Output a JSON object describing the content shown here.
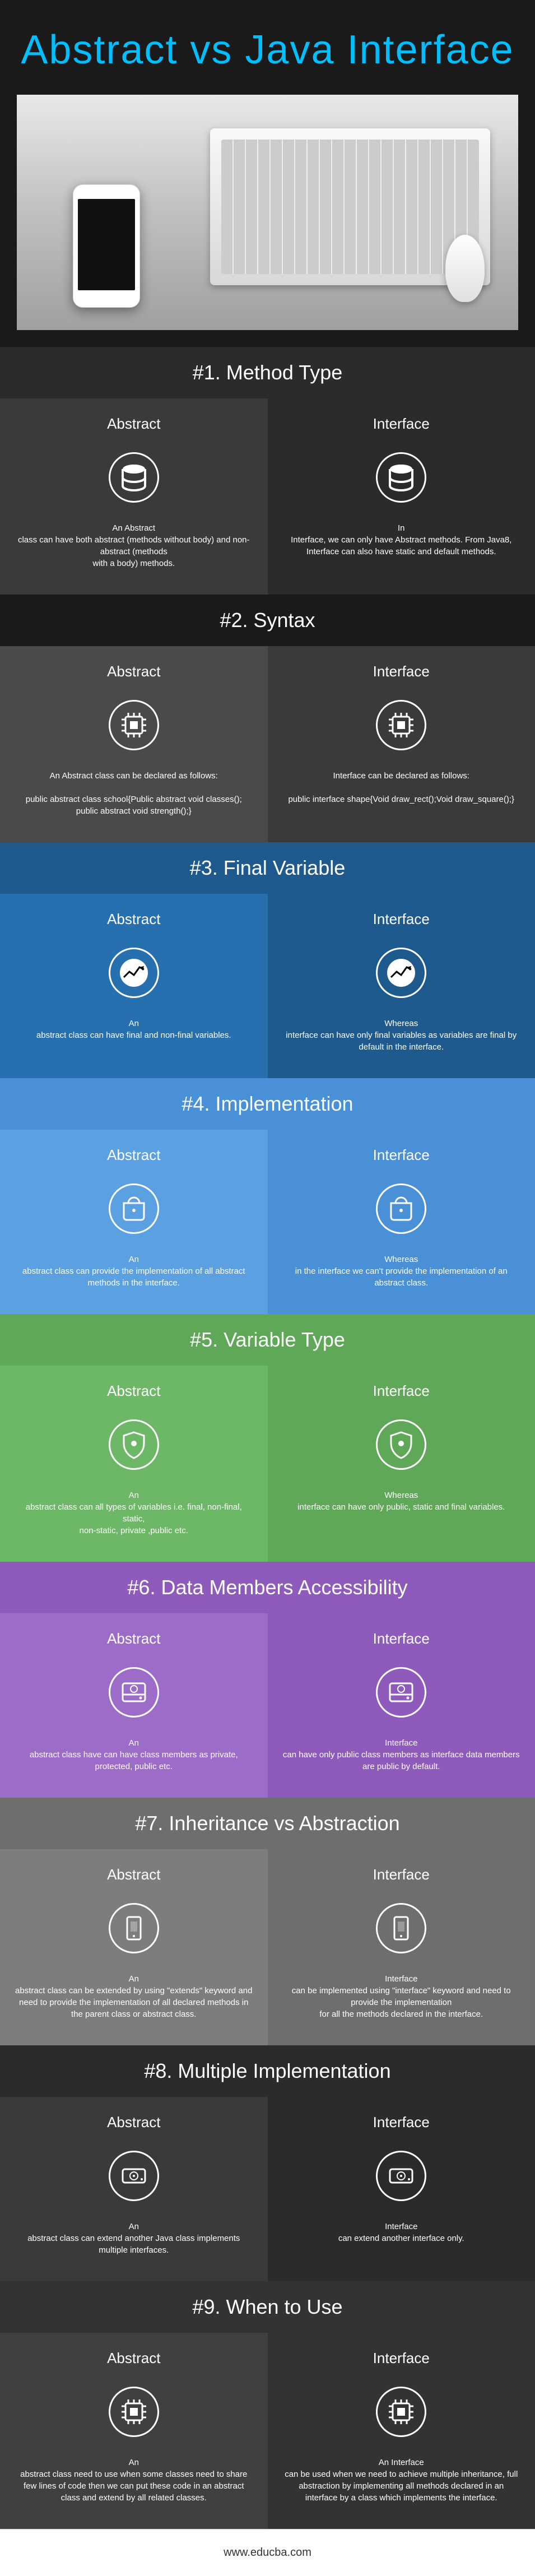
{
  "title": "Abstract vs Java Interface",
  "footer": "www.educba.com",
  "sections": [
    {
      "header": "#1. Method  Type",
      "headerClass": "rowdark",
      "colClass": [
        "bg-d1",
        "bg-d2"
      ],
      "icon": "database",
      "left": {
        "title": "Abstract",
        "text": "An Abstract\nclass can have both abstract (methods without body) and non-abstract (methods\nwith a body) methods."
      },
      "right": {
        "title": "Interface",
        "text": "In\nInterface, we can only have Abstract methods. From Java8, Interface can also have static and default methods."
      }
    },
    {
      "header": "#2. Syntax",
      "headerClass": "rowdarker",
      "colClass": [
        "bg-dk1",
        "bg-dk2"
      ],
      "icon": "chip",
      "left": {
        "title": "Abstract",
        "text": "An Abstract class can be declared as follows:\n\npublic abstract class school{Public abstract void classes();\npublic abstract void strength();}"
      },
      "right": {
        "title": "Interface",
        "text": "Interface can be declared as follows:\n\npublic interface shape{Void draw_rect();Void draw_square();}"
      }
    },
    {
      "header": "#3. Final Variable",
      "headerClass": "rowblue",
      "colClass": [
        "bg-bl1",
        "bg-bl2"
      ],
      "icon": "chart",
      "left": {
        "title": "Abstract",
        "text": "An\nabstract class can have final and non-final variables."
      },
      "right": {
        "title": "Interface",
        "text": "Whereas\ninterface can have only final variables as variables are final by default in the interface."
      }
    },
    {
      "header": "#4. Implementation",
      "headerClass": "rowbluelight",
      "colClass": [
        "bg-bll1",
        "bg-bll2"
      ],
      "icon": "inbox",
      "left": {
        "title": "Abstract",
        "text": "An\nabstract class can provide the implementation of all abstract methods in the interface."
      },
      "right": {
        "title": "Interface",
        "text": "Whereas\nin the interface we can't provide the implementation of an abstract class."
      }
    },
    {
      "header": "#5. Variable Type",
      "headerClass": "rowgreen",
      "colClass": [
        "bg-gr1",
        "bg-gr2"
      ],
      "icon": "shield",
      "left": {
        "title": "Abstract",
        "text": "An\nabstract class can all types of variables i.e. final, non-final, static,\nnon-static, private ,public etc."
      },
      "right": {
        "title": "Interface",
        "text": "Whereas\ninterface can have only public, static and final variables."
      }
    },
    {
      "header": "#6. Data Members Accessibility",
      "headerClass": "rowpurple",
      "colClass": [
        "bg-pu1",
        "bg-pu2"
      ],
      "icon": "hdd",
      "left": {
        "title": "Abstract",
        "text": "An\nabstract class have can have class members as private, protected, public etc."
      },
      "right": {
        "title": "Interface",
        "text": "Interface\ncan have only public class members as interface data members are public by default."
      }
    },
    {
      "header": "#7. Inheritance vs Abstraction",
      "headerClass": "rowgray",
      "colClass": [
        "bg-gy1",
        "bg-gy2"
      ],
      "icon": "device",
      "left": {
        "title": "Abstract",
        "text": "An\nabstract class can be extended by using \"extends\" keyword and need to provide the implementation of all declared methods in the parent class or abstract class."
      },
      "right": {
        "title": "Interface",
        "text": "Interface\ncan be implemented using \"interface\" keyword and need to provide the implementation\nfor all the methods declared in the interface."
      }
    },
    {
      "header": "#8. Multiple Implementation",
      "headerClass": "rowdark",
      "colClass": [
        "bg-d1",
        "bg-d2"
      ],
      "icon": "disk",
      "left": {
        "title": "Abstract",
        "text": "An\nabstract class can extend another Java class implements multiple interfaces."
      },
      "right": {
        "title": "Interface",
        "text": "Interface\ncan extend another interface only."
      }
    },
    {
      "header": "#9. When to Use",
      "headerClass": "rowfooter",
      "colClass": [
        "bg-ft1",
        "bg-ft2"
      ],
      "icon": "chip",
      "left": {
        "title": "Abstract",
        "text": "An\nabstract class need to use when some classes need to share few lines of code then we can put these code in an abstract class and extend by all related classes."
      },
      "right": {
        "title": "Interface",
        "text": "An Interface\ncan be used when we need to achieve multiple inheritance, full abstraction by implementing all methods declared in an interface by a class which implements the interface."
      }
    }
  ]
}
